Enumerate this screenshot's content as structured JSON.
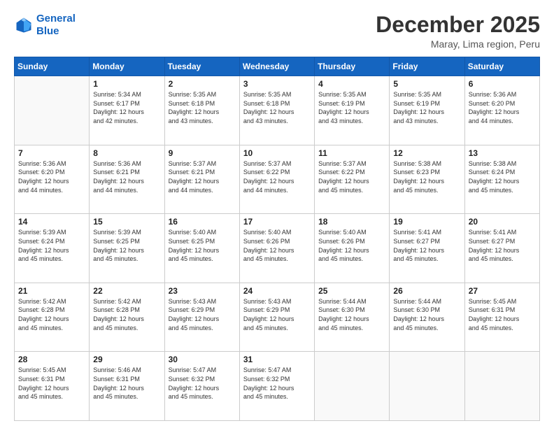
{
  "logo": {
    "line1": "General",
    "line2": "Blue"
  },
  "title": "December 2025",
  "subtitle": "Maray, Lima region, Peru",
  "weekdays": [
    "Sunday",
    "Monday",
    "Tuesday",
    "Wednesday",
    "Thursday",
    "Friday",
    "Saturday"
  ],
  "weeks": [
    [
      {
        "day": "",
        "info": ""
      },
      {
        "day": "1",
        "info": "Sunrise: 5:34 AM\nSunset: 6:17 PM\nDaylight: 12 hours\nand 42 minutes."
      },
      {
        "day": "2",
        "info": "Sunrise: 5:35 AM\nSunset: 6:18 PM\nDaylight: 12 hours\nand 43 minutes."
      },
      {
        "day": "3",
        "info": "Sunrise: 5:35 AM\nSunset: 6:18 PM\nDaylight: 12 hours\nand 43 minutes."
      },
      {
        "day": "4",
        "info": "Sunrise: 5:35 AM\nSunset: 6:19 PM\nDaylight: 12 hours\nand 43 minutes."
      },
      {
        "day": "5",
        "info": "Sunrise: 5:35 AM\nSunset: 6:19 PM\nDaylight: 12 hours\nand 43 minutes."
      },
      {
        "day": "6",
        "info": "Sunrise: 5:36 AM\nSunset: 6:20 PM\nDaylight: 12 hours\nand 44 minutes."
      }
    ],
    [
      {
        "day": "7",
        "info": "Sunrise: 5:36 AM\nSunset: 6:20 PM\nDaylight: 12 hours\nand 44 minutes."
      },
      {
        "day": "8",
        "info": "Sunrise: 5:36 AM\nSunset: 6:21 PM\nDaylight: 12 hours\nand 44 minutes."
      },
      {
        "day": "9",
        "info": "Sunrise: 5:37 AM\nSunset: 6:21 PM\nDaylight: 12 hours\nand 44 minutes."
      },
      {
        "day": "10",
        "info": "Sunrise: 5:37 AM\nSunset: 6:22 PM\nDaylight: 12 hours\nand 44 minutes."
      },
      {
        "day": "11",
        "info": "Sunrise: 5:37 AM\nSunset: 6:22 PM\nDaylight: 12 hours\nand 45 minutes."
      },
      {
        "day": "12",
        "info": "Sunrise: 5:38 AM\nSunset: 6:23 PM\nDaylight: 12 hours\nand 45 minutes."
      },
      {
        "day": "13",
        "info": "Sunrise: 5:38 AM\nSunset: 6:24 PM\nDaylight: 12 hours\nand 45 minutes."
      }
    ],
    [
      {
        "day": "14",
        "info": "Sunrise: 5:39 AM\nSunset: 6:24 PM\nDaylight: 12 hours\nand 45 minutes."
      },
      {
        "day": "15",
        "info": "Sunrise: 5:39 AM\nSunset: 6:25 PM\nDaylight: 12 hours\nand 45 minutes."
      },
      {
        "day": "16",
        "info": "Sunrise: 5:40 AM\nSunset: 6:25 PM\nDaylight: 12 hours\nand 45 minutes."
      },
      {
        "day": "17",
        "info": "Sunrise: 5:40 AM\nSunset: 6:26 PM\nDaylight: 12 hours\nand 45 minutes."
      },
      {
        "day": "18",
        "info": "Sunrise: 5:40 AM\nSunset: 6:26 PM\nDaylight: 12 hours\nand 45 minutes."
      },
      {
        "day": "19",
        "info": "Sunrise: 5:41 AM\nSunset: 6:27 PM\nDaylight: 12 hours\nand 45 minutes."
      },
      {
        "day": "20",
        "info": "Sunrise: 5:41 AM\nSunset: 6:27 PM\nDaylight: 12 hours\nand 45 minutes."
      }
    ],
    [
      {
        "day": "21",
        "info": "Sunrise: 5:42 AM\nSunset: 6:28 PM\nDaylight: 12 hours\nand 45 minutes."
      },
      {
        "day": "22",
        "info": "Sunrise: 5:42 AM\nSunset: 6:28 PM\nDaylight: 12 hours\nand 45 minutes."
      },
      {
        "day": "23",
        "info": "Sunrise: 5:43 AM\nSunset: 6:29 PM\nDaylight: 12 hours\nand 45 minutes."
      },
      {
        "day": "24",
        "info": "Sunrise: 5:43 AM\nSunset: 6:29 PM\nDaylight: 12 hours\nand 45 minutes."
      },
      {
        "day": "25",
        "info": "Sunrise: 5:44 AM\nSunset: 6:30 PM\nDaylight: 12 hours\nand 45 minutes."
      },
      {
        "day": "26",
        "info": "Sunrise: 5:44 AM\nSunset: 6:30 PM\nDaylight: 12 hours\nand 45 minutes."
      },
      {
        "day": "27",
        "info": "Sunrise: 5:45 AM\nSunset: 6:31 PM\nDaylight: 12 hours\nand 45 minutes."
      }
    ],
    [
      {
        "day": "28",
        "info": "Sunrise: 5:45 AM\nSunset: 6:31 PM\nDaylight: 12 hours\nand 45 minutes."
      },
      {
        "day": "29",
        "info": "Sunrise: 5:46 AM\nSunset: 6:31 PM\nDaylight: 12 hours\nand 45 minutes."
      },
      {
        "day": "30",
        "info": "Sunrise: 5:47 AM\nSunset: 6:32 PM\nDaylight: 12 hours\nand 45 minutes."
      },
      {
        "day": "31",
        "info": "Sunrise: 5:47 AM\nSunset: 6:32 PM\nDaylight: 12 hours\nand 45 minutes."
      },
      {
        "day": "",
        "info": ""
      },
      {
        "day": "",
        "info": ""
      },
      {
        "day": "",
        "info": ""
      }
    ]
  ]
}
